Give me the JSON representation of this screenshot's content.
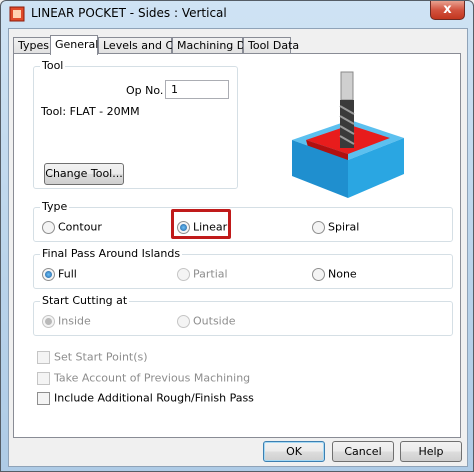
{
  "window": {
    "title": "LINEAR POCKET - Sides : Vertical",
    "close_glyph": "x"
  },
  "tabs": [
    {
      "label": "Types",
      "active": false
    },
    {
      "label": "General",
      "active": true
    },
    {
      "label": "Levels and Cuts",
      "active": false
    },
    {
      "label": "Machining Data",
      "active": false
    },
    {
      "label": "Tool Data",
      "active": false
    }
  ],
  "tool_group": {
    "label": "Tool",
    "op_no_label": "Op No.",
    "op_no_value": "1",
    "tool_text": "Tool: FLAT - 20MM",
    "change_tool_label": "Change Tool..."
  },
  "type_group": {
    "label": "Type",
    "options": [
      {
        "label": "Contour",
        "checked": false,
        "disabled": false
      },
      {
        "label": "Linear",
        "checked": true,
        "disabled": false
      },
      {
        "label": "Spiral",
        "checked": false,
        "disabled": false
      }
    ]
  },
  "final_pass_group": {
    "label": "Final Pass Around Islands",
    "options": [
      {
        "label": "Full",
        "checked": true,
        "disabled": false
      },
      {
        "label": "Partial",
        "checked": false,
        "disabled": true
      },
      {
        "label": "None",
        "checked": false,
        "disabled": false
      }
    ]
  },
  "start_cutting_group": {
    "label": "Start Cutting at",
    "options": [
      {
        "label": "Inside",
        "checked": true,
        "disabled": true
      },
      {
        "label": "Outside",
        "checked": false,
        "disabled": true
      }
    ]
  },
  "checkboxes": [
    {
      "label": "Set Start Point(s)",
      "checked": false,
      "disabled": true
    },
    {
      "label": "Take Account of Previous Machining",
      "checked": false,
      "disabled": true
    },
    {
      "label": "Include Additional Rough/Finish Pass",
      "checked": false,
      "disabled": false
    }
  ],
  "buttons": {
    "ok": "OK",
    "cancel": "Cancel",
    "help": "Help"
  },
  "colors": {
    "highlight": "#c01a1a",
    "pocket_block": "#2b9bd6",
    "pocket_floor": "#e01818"
  },
  "icons": {
    "app": "pocket-app-icon",
    "preview": "pocket-tool-preview-illustration"
  }
}
